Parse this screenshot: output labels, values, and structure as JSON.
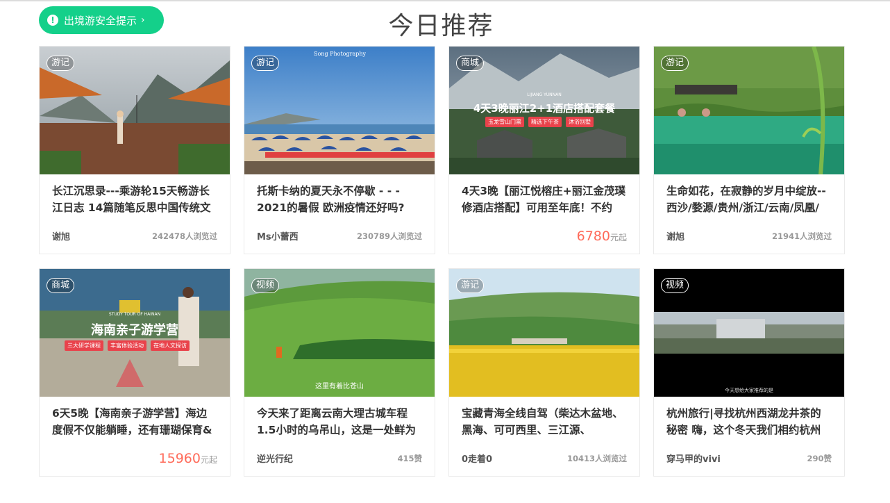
{
  "header": {
    "safety_label": "出境游安全提示",
    "title": "今日推荐"
  },
  "cards": [
    {
      "tag": "游记",
      "title": "长江沉思录---乘游轮15天畅游长江日志 14篇随笔反思中国传统文",
      "author": "谢旭",
      "views": "242478人浏览过"
    },
    {
      "tag": "游记",
      "title": "托斯卡纳的夏天永不停歇 - - - 2021的暑假 欧洲疫情还好吗?",
      "author": "Ms小蕾西",
      "views": "230789人浏览过",
      "photo_caption": "Song Photography"
    },
    {
      "tag": "商城",
      "title": "4天3晚【丽江悦榕庄+丽江金茂璞修酒店搭配】可用至年底！不约",
      "price": "6780",
      "price_unit": "元起",
      "banner": {
        "sub": "LIJIANG YUNNAN",
        "headline": "4天3晚丽江2+1酒店搭配套餐",
        "chips": [
          "玉龙雪山门票",
          "精选下午茶",
          "沐浴别墅"
        ]
      }
    },
    {
      "tag": "游记",
      "title": "生命如花，在寂静的岁月中绽放--西沙/婺源/贵州/浙江/云南/凤凰/",
      "author": "谢旭",
      "views": "21941人浏览过"
    },
    {
      "tag": "商城",
      "title": "6天5晚【海南亲子游学营】海边度假不仅能躺睡，还有珊瑚保育&",
      "price": "15960",
      "price_unit": "元起",
      "banner": {
        "sub": "STUDY TOUR OF HAINAN",
        "headline": "海南亲子游学营",
        "chips": [
          "三大研学课程",
          "丰富体验活动",
          "在地人文探访"
        ]
      }
    },
    {
      "tag": "视频",
      "title": "今天来了距离云南大理古城车程1.5小时的乌吊山，这是一处鲜为",
      "author": "逆光行纪",
      "views": "415赞",
      "subtitle": "这里有着比苍山"
    },
    {
      "tag": "游记",
      "title": "宝藏青海全线自驾（柴达木盆地、黑海、可可西里、三江源、",
      "author": "0走着0",
      "views": "10413人浏览过"
    },
    {
      "tag": "视频",
      "title": "杭州旅行|寻找杭州西湖龙井茶的秘密 嗨，这个冬天我们相约杭州",
      "author": "穿马甲的vivi",
      "views": "290赞",
      "subtitle": "今天想给大家推荐的是"
    }
  ]
}
